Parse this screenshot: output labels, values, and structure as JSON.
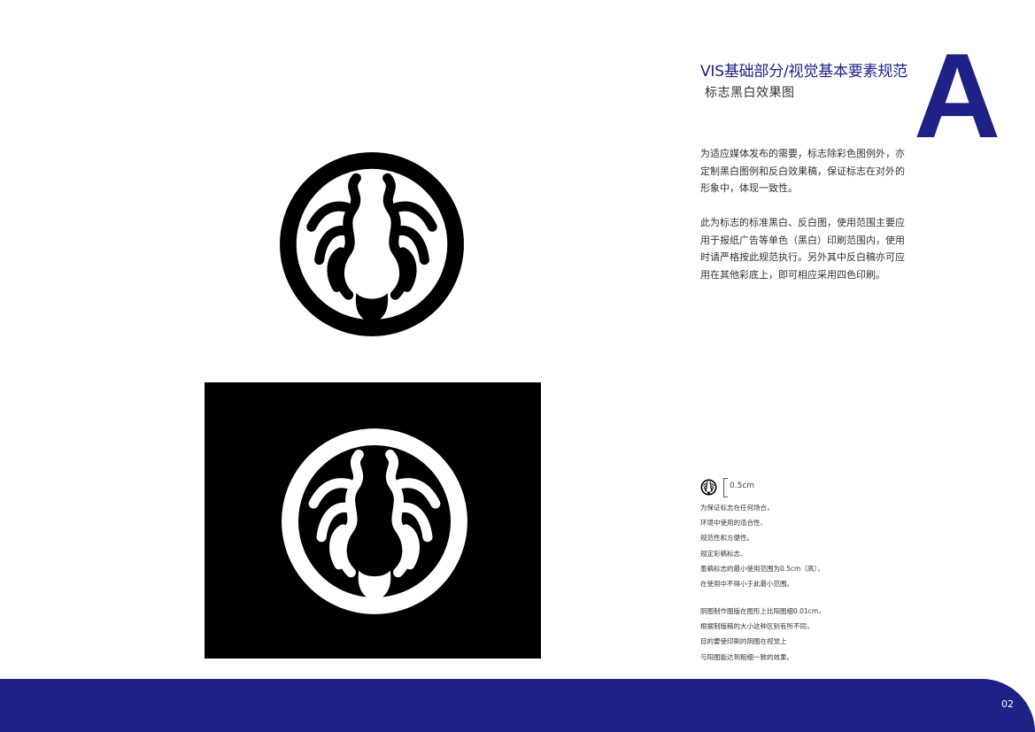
{
  "header": {
    "title": "VIS基础部分/视觉基本要素规范",
    "subtitle": "标志黑白效果图",
    "section_letter": "A"
  },
  "description": {
    "paragraph_1": "为适应媒体发布的需要，标志除彩色图例外，亦定制黑白图例和反白效果稿，保证标志在对外的形象中，体现一致性。",
    "paragraph_2": "此为标志的标准黑白、反白图，使用范围主要应用于报纸广告等单色（黑白）印刷范围内，使用时请严格按此规范执行。另外其中反白稿亦可应用在其他彩底上，即可相应采用四色印刷。"
  },
  "min_size": {
    "size_label": "0.5cm",
    "notes_1": [
      "为保证标志在任何场合，",
      "环境中使用的适合性、",
      "规范性和方便性。",
      "规定彩稿标志、",
      "墨稿标志的最小使用范围为0.5cm（高），",
      "在使用中不得小于此最小范围。"
    ],
    "notes_2": [
      "阴图制作图版在图形上比阳图细0.01cm，",
      "根据制版稿的大小这种区别有所不同，",
      "目的要使印刷的阴图在视觉上",
      "与阳图能达到粗细一致的效果。"
    ]
  },
  "footer": {
    "page_number": "02"
  },
  "colors": {
    "brand": "#1e2186",
    "black": "#000000",
    "white": "#ffffff"
  }
}
